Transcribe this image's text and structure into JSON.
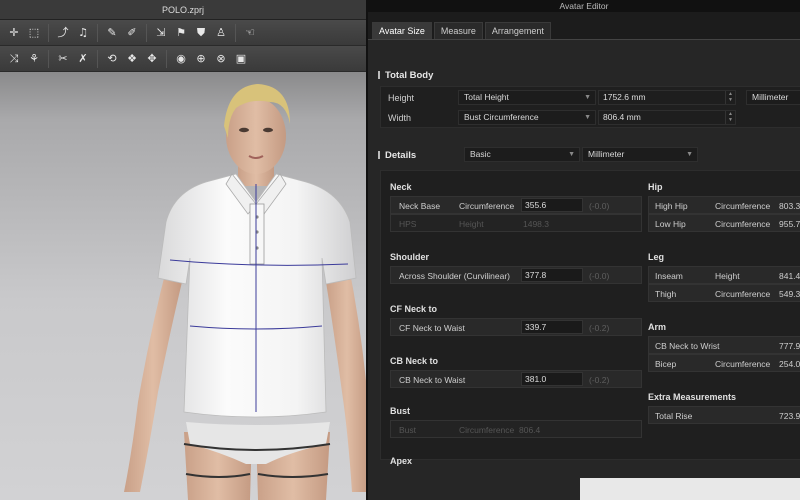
{
  "viewport": {
    "file_title": "POLO.zprj",
    "toolbar1_icons": [
      "add-point-icon",
      "rect-select-icon",
      "transform-icon",
      "sewing-icon",
      "pen-icon",
      "brush-icon",
      "fold-icon",
      "pin-icon",
      "shirt-icon",
      "avatar-icon",
      "mannequin-icon",
      "hand-icon"
    ],
    "toolbar2_icons": [
      "tack-icon",
      "shirt-tack-icon",
      "cut-icon",
      "knife-icon",
      "fold-arrange-icon",
      "button-icon",
      "buttonhole-icon",
      "sphere-icon",
      "globe-icon",
      "measure-icon",
      "tape-icon"
    ]
  },
  "editor": {
    "title": "Avatar Editor",
    "tabs": [
      "Avatar Size",
      "Measure",
      "Arrangement"
    ],
    "total_body": {
      "title": "Total Body",
      "height_label": "Height",
      "height_combo": "Total Height",
      "height_value": "1752.6 mm",
      "unit": "Millimeter",
      "width_label": "Width",
      "width_combo": "Bust Circumference",
      "width_value": "806.4 mm"
    },
    "details": {
      "title": "Details",
      "mode": "Basic",
      "unit": "Millimeter"
    },
    "neck": {
      "title": "Neck",
      "rows": [
        {
          "name": "Neck Base",
          "type": "Circumference",
          "value": "355.6",
          "delta": "(-0.0)",
          "disabled": false
        },
        {
          "name": "HPS",
          "type": "Height",
          "value": "1498.3",
          "delta": "",
          "disabled": true
        }
      ]
    },
    "shoulder": {
      "title": "Shoulder",
      "rows": [
        {
          "name": "Across Shoulder (Curvilinear)",
          "value": "377.8",
          "delta": "(-0.0)"
        }
      ]
    },
    "cf_neck": {
      "title": "CF Neck to",
      "rows": [
        {
          "name": "CF Neck to Waist",
          "value": "339.7",
          "delta": "(-0.2)"
        }
      ]
    },
    "cb_neck": {
      "title": "CB Neck to",
      "rows": [
        {
          "name": "CB Neck to Waist",
          "value": "381.0",
          "delta": "(-0.2)"
        }
      ]
    },
    "bust": {
      "title": "Bust",
      "rows": [
        {
          "name": "Bust",
          "type": "Circumference",
          "value": "806.4"
        }
      ]
    },
    "apex_title": "Apex",
    "hip": {
      "title": "Hip",
      "rows": [
        {
          "name": "High Hip",
          "type": "Circumference",
          "value": "803.3"
        },
        {
          "name": "Low Hip",
          "type": "Circumference",
          "value": "955.7"
        }
      ]
    },
    "leg": {
      "title": "Leg",
      "rows": [
        {
          "name": "Inseam",
          "type": "Height",
          "value": "841.4"
        },
        {
          "name": "Thigh",
          "type": "Circumference",
          "value": "549.3"
        }
      ]
    },
    "arm": {
      "title": "Arm",
      "rows": [
        {
          "name": "CB Neck to Wrist",
          "type": "",
          "value": "777.9"
        },
        {
          "name": "Bicep",
          "type": "Circumference",
          "value": "254.0"
        }
      ]
    },
    "extra": {
      "title": "Extra Measurements",
      "rows": [
        {
          "name": "Total Rise",
          "value": "723.9"
        }
      ]
    }
  },
  "colors": {
    "panel": "#262626",
    "accent": "#e6e6e6",
    "shirt": "#f5f5f5"
  }
}
